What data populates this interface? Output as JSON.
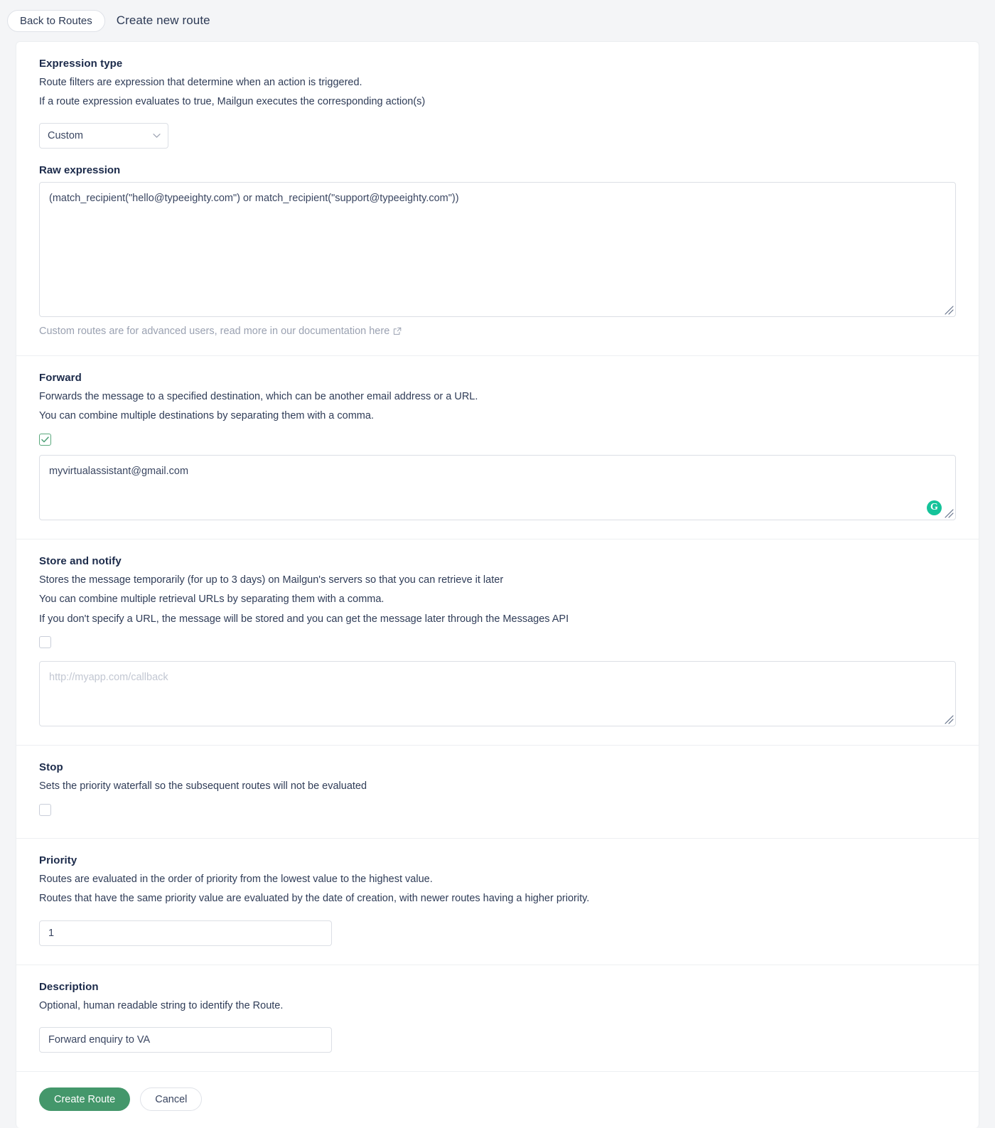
{
  "header": {
    "back_label": "Back to Routes",
    "title": "Create new route"
  },
  "expression_type": {
    "title": "Expression type",
    "line1": "Route filters are expression that determine when an action is triggered.",
    "line2": "If a route expression evaluates to true, Mailgun executes the corresponding action(s)",
    "select_value": "Custom",
    "select_options": [
      "Custom"
    ],
    "chevron_icon": "chevron-down-icon"
  },
  "raw_expression": {
    "label": "Raw expression",
    "value": "(match_recipient(\"hello@typeeighty.com\") or match_recipient(\"support@typeeighty.com\"))",
    "placeholder": "",
    "helper_text": "Custom routes are for advanced users, read more in our documentation here",
    "helper_icon": "external-link-icon"
  },
  "forward": {
    "title": "Forward",
    "line1": "Forwards the message to a specified destination, which can be another email address or a URL.",
    "line2": "You can combine multiple destinations by separating them with a comma.",
    "checked": true,
    "value": "myvirtualassistant@gmail.com",
    "placeholder": "",
    "grammarly_label": "G"
  },
  "store_and_notify": {
    "title": "Store and notify",
    "line1": "Stores the message temporarily (for up to 3 days) on Mailgun's servers so that you can retrieve it later",
    "line2": "You can combine multiple retrieval URLs by separating them with a comma.",
    "line3": "If you don't specify a URL, the message will be stored and you can get the message later through the Messages API",
    "checked": false,
    "value": "",
    "placeholder": "http://myapp.com/callback"
  },
  "stop": {
    "title": "Stop",
    "line1": "Sets the priority waterfall so the subsequent routes will not be evaluated",
    "checked": false
  },
  "priority": {
    "title": "Priority",
    "line1": "Routes are evaluated in the order of priority from the lowest value to the highest value.",
    "line2": "Routes that have the same priority value are evaluated by the date of creation, with newer routes having a higher priority.",
    "value": "1",
    "placeholder": ""
  },
  "description": {
    "title": "Description",
    "line1": "Optional, human readable string to identify the Route.",
    "value": "Forward enquiry to VA",
    "placeholder": ""
  },
  "footer": {
    "submit_label": "Create Route",
    "cancel_label": "Cancel"
  },
  "colors": {
    "accent_green": "#44976b",
    "grammarly_green": "#15c39a",
    "page_bg": "#f4f5f7",
    "text": "#1f2a44"
  }
}
